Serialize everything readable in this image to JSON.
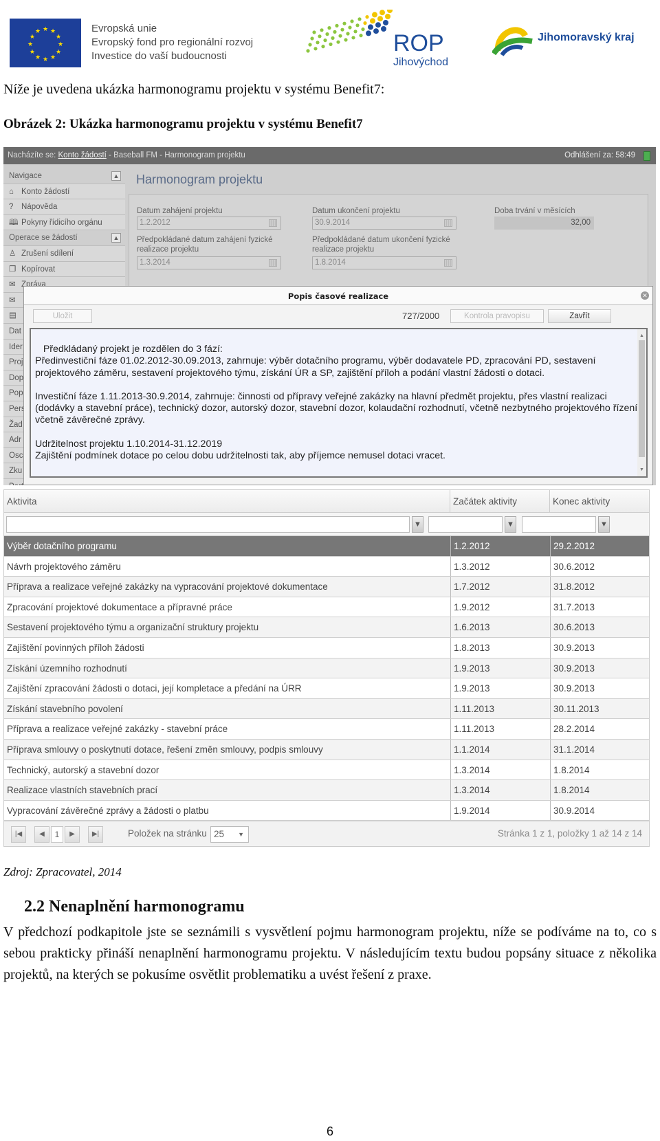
{
  "header": {
    "eu_logo_lines": [
      "Evropská unie",
      "Evropský fond pro regionální rozvoj",
      "Investice do vaší budoucnosti"
    ],
    "rop_logo": {
      "title": "ROP",
      "subtitle": "Jihovýchod"
    },
    "jmk_logo": "Jihomoravský kraj",
    "colors": {
      "eu_blue": "#1d3f99",
      "eu_star": "#ffdd00",
      "rop_blue": "#1f4e9b",
      "rop_green": "#8cc63f",
      "jmk_yellow": "#f2c500",
      "jmk_green": "#3aa335"
    }
  },
  "intro": "Níže je uvedena ukázka harmonogramu projektu v systému Benefit7:",
  "caption": "Obrázek 2: Ukázka harmonogramu projektu v systému Benefit7",
  "app": {
    "breadcrumb": {
      "prefix": "Nacházíte se: ",
      "link": "Konto žádostí",
      "rest": " - Baseball FM - Harmonogram projektu"
    },
    "logout_timer": "Odhlášení za: 58:49",
    "sidebar": [
      {
        "label": "Navigace",
        "header": true
      },
      {
        "label": "Konto žádostí",
        "icon": "⌂"
      },
      {
        "label": "Nápověda",
        "icon": "?"
      },
      {
        "label": "Pokyny řídicího orgánu",
        "icon": "🕮"
      },
      {
        "label": "Operace se žádostí",
        "header": true
      },
      {
        "label": "Zrušení sdílení",
        "icon": "♙"
      },
      {
        "label": "Kopírovat",
        "icon": "❐"
      },
      {
        "label": "Zpráva",
        "icon": "✉"
      },
      {
        "label": "",
        "icon": "✉"
      },
      {
        "label": "",
        "icon": "▤"
      },
      {
        "label": "Dat"
      },
      {
        "label": "Ider"
      },
      {
        "label": "Proj"
      },
      {
        "label": "Dop"
      },
      {
        "label": "Pop"
      },
      {
        "label": "Pers"
      },
      {
        "label": "Žad"
      },
      {
        "label": "Adr"
      },
      {
        "label": "Osc"
      },
      {
        "label": "Zku"
      },
      {
        "label": "Part"
      }
    ],
    "page_title": "Harmonogram projektu",
    "fields": {
      "start_label": "Datum zahájení projektu",
      "start_value": "1.2.2012",
      "end_label": "Datum ukončení projektu",
      "end_value": "30.9.2014",
      "duration_label": "Doba trvání v měsících",
      "duration_value": "32,00",
      "phys_start_label": "Předpokládané datum zahájení fyzické realizace projektu",
      "phys_start_value": "1.3.2014",
      "phys_end_label": "Předpokládané datum ukončení fyzické realizace projektu",
      "phys_end_value": "1.8.2014"
    },
    "modal": {
      "title": "Popis časové realizace",
      "save": "Uložit",
      "counter": "727/2000",
      "spellcheck": "Kontrola pravopisu",
      "close": "Zavřít",
      "text": "Předkládaný projekt je rozdělen do 3 fází:\nPředinvestiční fáze 01.02.2012-30.09.2013, zahrnuje: výběr dotačního programu, výběr dodavatele PD, zpracování PD, sestavení projektového záměru, sestavení projektového týmu, získání ÚR a SP, zajištění příloh a podání vlastní žádosti o dotaci.\n\nInvestiční fáze 1.11.2013-30.9.2014, zahrnuje: činnosti od přípravy veřejné zakázky na hlavní předmět projektu, přes vlastní realizaci (dodávky a stavební práce), technický dozor, autorský dozor, stavební dozor, kolaudační rozhodnutí, včetně nezbytného projektového řízení, včetně závěrečné zprávy.\n\nUdržitelnost projektu 1.10.2014-31.12.2019\nZajištění podmínek dotace po celou dobu udržitelnosti tak, aby příjemce nemusel dotaci vracet."
    }
  },
  "grid": {
    "columns": [
      "Aktivita",
      "Začátek aktivity",
      "Konec aktivity"
    ],
    "rows": [
      [
        "Výběr dotačního programu",
        "1.2.2012",
        "29.2.2012"
      ],
      [
        "Návrh projektového záměru",
        "1.3.2012",
        "30.6.2012"
      ],
      [
        "Příprava a realizace veřejné zakázky na vypracování projektové dokumentace",
        "1.7.2012",
        "31.8.2012"
      ],
      [
        "Zpracování projektové dokumentace a přípravné práce",
        "1.9.2012",
        "31.7.2013"
      ],
      [
        "Sestavení projektového týmu a organizační struktury projektu",
        "1.6.2013",
        "30.6.2013"
      ],
      [
        "Zajištění povinných příloh žádosti",
        "1.8.2013",
        "30.9.2013"
      ],
      [
        "Získání územního rozhodnutí",
        "1.9.2013",
        "30.9.2013"
      ],
      [
        "Zajištění zpracování žádosti o dotaci, její kompletace a předání na ÚRR",
        "1.9.2013",
        "30.9.2013"
      ],
      [
        "Získání stavebního povolení",
        "1.11.2013",
        "30.11.2013"
      ],
      [
        "Příprava a realizace veřejné zakázky - stavební práce",
        "1.11.2013",
        "28.2.2014"
      ],
      [
        "Příprava smlouvy o poskytnutí dotace, řešení změn smlouvy, podpis smlouvy",
        "1.1.2014",
        "31.1.2014"
      ],
      [
        "Technický, autorský a stavební dozor",
        "1.3.2014",
        "1.8.2014"
      ],
      [
        "Realizace vlastních stavebních prací",
        "1.3.2014",
        "1.8.2014"
      ],
      [
        "Vypracování závěrečné zprávy a žádosti o platbu",
        "1.9.2014",
        "30.9.2014"
      ]
    ],
    "pager": {
      "page": "1",
      "per_page_label": "Položek na stránku",
      "per_page": "25",
      "summary": "Stránka 1 z 1, položky 1 až 14 z 14"
    }
  },
  "source": "Zdroj: Zpracovatel, 2014",
  "section_heading": "2.2 Nenaplnění harmonogramu",
  "paragraph": "V předchozí podkapitole jste se seznámili s vysvětlení pojmu harmonogram projektu, níže se podíváme na to, co s sebou prakticky přináší nenaplnění harmonogramu projektu. V následujícím textu budou popsány situace z několika projektů, na kterých se pokusíme osvětlit problematiku a uvést řešení z praxe.",
  "page_number": "6"
}
